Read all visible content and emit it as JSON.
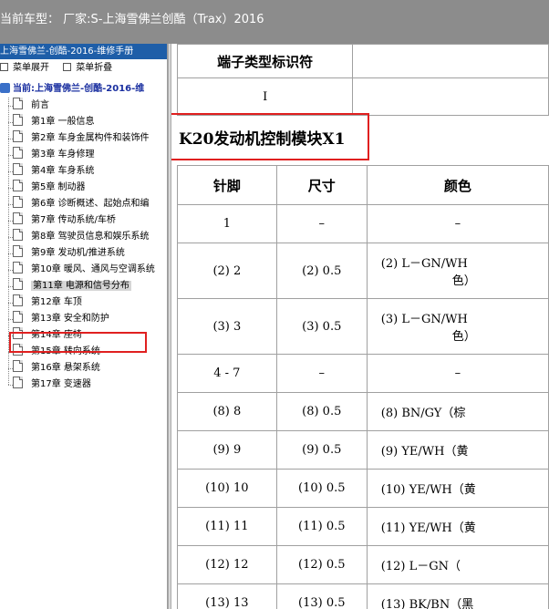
{
  "topbar": {
    "title": "当前车型：  厂家:S-上海雪佛兰创酷（Trax）2016"
  },
  "sidebar": {
    "header": "上海雪佛兰-创酷-2016-维修手册",
    "expand_label": "菜单展开",
    "collapse_label": "菜单折叠",
    "root_label": "当前:上海雪佛兰-创酷-2016-维",
    "items": [
      "前言",
      "第1章 一般信息",
      "第2章 车身金属构件和装饰件",
      "第3章 车身修理",
      "第4章 车身系统",
      "第5章 制动器",
      "第6章 诊断概述、起始点和编",
      "第7章 传动系统/车桥",
      "第8章 驾驶员信息和娱乐系统",
      "第9章 发动机/推进系统",
      "第10章 暖风、通风与空调系统",
      "第11章 电源和信号分布",
      "第12章 车顶",
      "第13章 安全和防护",
      "第14章 座椅",
      "第15章 转向系统",
      "第16章 悬架系统",
      "第17章 变速器"
    ],
    "selected_index": 11
  },
  "connector_table": {
    "header": "端子类型标识符",
    "value": "I"
  },
  "section_title": "K20发动机控制模块X1",
  "pin_table": {
    "headers": [
      "针脚",
      "尺寸",
      "颜色"
    ],
    "rows": [
      {
        "pin": "1",
        "size": "–",
        "color": "–",
        "color2": "",
        "tall": false
      },
      {
        "pin": "(2) 2",
        "size": "(2) 0.5",
        "color": "(2) L－GN/WH",
        "color2": "色）",
        "tall": true
      },
      {
        "pin": "(3) 3",
        "size": "(3) 0.5",
        "color": "(3) L－GN/WH",
        "color2": "色）",
        "tall": true
      },
      {
        "pin": "4 - 7",
        "size": "–",
        "color": "–",
        "color2": "",
        "tall": false
      },
      {
        "pin": "(8) 8",
        "size": "(8) 0.5",
        "color": "(8) BN/GY（棕",
        "color2": "",
        "tall": false
      },
      {
        "pin": "(9) 9",
        "size": "(9) 0.5",
        "color": "(9) YE/WH（黄",
        "color2": "",
        "tall": false
      },
      {
        "pin": "(10) 10",
        "size": "(10) 0.5",
        "color": "(10) YE/WH（黄",
        "color2": "",
        "tall": false
      },
      {
        "pin": "(11) 11",
        "size": "(11) 0.5",
        "color": "(11) YE/WH（黄",
        "color2": "",
        "tall": false
      },
      {
        "pin": "(12) 12",
        "size": "(12) 0.5",
        "color": "(12) L－GN（",
        "color2": "",
        "tall": false
      },
      {
        "pin": "(13) 13",
        "size": "(13) 0.5",
        "color": "(13) BK/BN（黑",
        "color2": "",
        "tall": false
      }
    ]
  },
  "colors": {
    "highlight_border": "#e02020",
    "sidebar_header_bg": "#1e5ea8",
    "topbar_bg": "#8c8c8c"
  }
}
